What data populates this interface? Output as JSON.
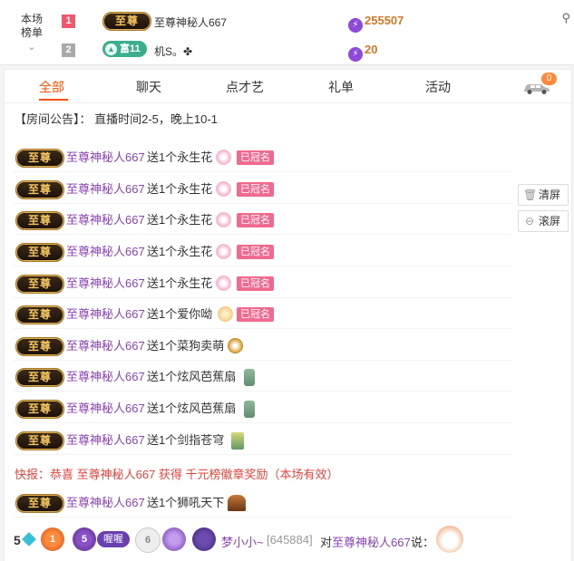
{
  "rank": {
    "toggle_label_1": "本场",
    "toggle_label_2": "榜单",
    "chevron": "⌄",
    "rows": [
      {
        "num": "1",
        "badge": "至尊",
        "name": "至尊神秘人667",
        "score": "255507"
      },
      {
        "num": "2",
        "badge": "富11",
        "name": "机S。✤",
        "score": "20"
      }
    ],
    "search_icon": "search-icon"
  },
  "tabs": [
    "全部",
    "聊天",
    "点才艺",
    "礼单",
    "活动"
  ],
  "car_count": "0",
  "announcement": "【房间公告】： 直播时间2-5，晚上10-1",
  "badge_text": "至尊",
  "messages": [
    {
      "user": "至尊神秘人667",
      "text": "送1个永生花",
      "gift": "flower",
      "tag": "已冠名"
    },
    {
      "user": "至尊神秘人667",
      "text": "送1个永生花",
      "gift": "flower",
      "tag": "已冠名"
    },
    {
      "user": "至尊神秘人667",
      "text": "送1个永生花",
      "gift": "flower",
      "tag": "已冠名"
    },
    {
      "user": "至尊神秘人667",
      "text": "送1个永生花",
      "gift": "flower",
      "tag": "已冠名"
    },
    {
      "user": "至尊神秘人667",
      "text": "送1个永生花",
      "gift": "flower",
      "tag": "已冠名"
    },
    {
      "user": "至尊神秘人667",
      "text": "送1个爱你呦",
      "gift": "love",
      "tag": "已冠名"
    },
    {
      "user": "至尊神秘人667",
      "text": "送1个菜狗卖萌",
      "gift": "dog",
      "tag": ""
    },
    {
      "user": "至尊神秘人667",
      "text": "送1个炫风芭蕉扇",
      "gift": "fan",
      "tag": ""
    },
    {
      "user": "至尊神秘人667",
      "text": "送1个炫风芭蕉扇",
      "gift": "fan",
      "tag": ""
    },
    {
      "user": "至尊神秘人667",
      "text": "送1个剑指苍穹",
      "gift": "sword",
      "tag": ""
    }
  ],
  "flash_news": "快报：恭喜 至尊神秘人667 获得 千元榜徽章奖励（本场有效）",
  "last_message": {
    "user": "至尊神秘人667",
    "text": "送1个狮吼天下",
    "gift": "lion"
  },
  "side_buttons": {
    "clear": "清屏",
    "roll": "滚屏"
  },
  "footer": {
    "level": "5",
    "medal1": "1",
    "medal2": "5",
    "nickname_badge": "喔喔",
    "medal3": "6",
    "user": "梦小小~",
    "uid": "[645884]",
    "to": "对",
    "target": "至尊神秘人667",
    "say": "说："
  },
  "colors": {
    "accent": "#ff5000",
    "username": "#8b43b5",
    "flash": "#e2453c",
    "tag": "#f06a90"
  }
}
